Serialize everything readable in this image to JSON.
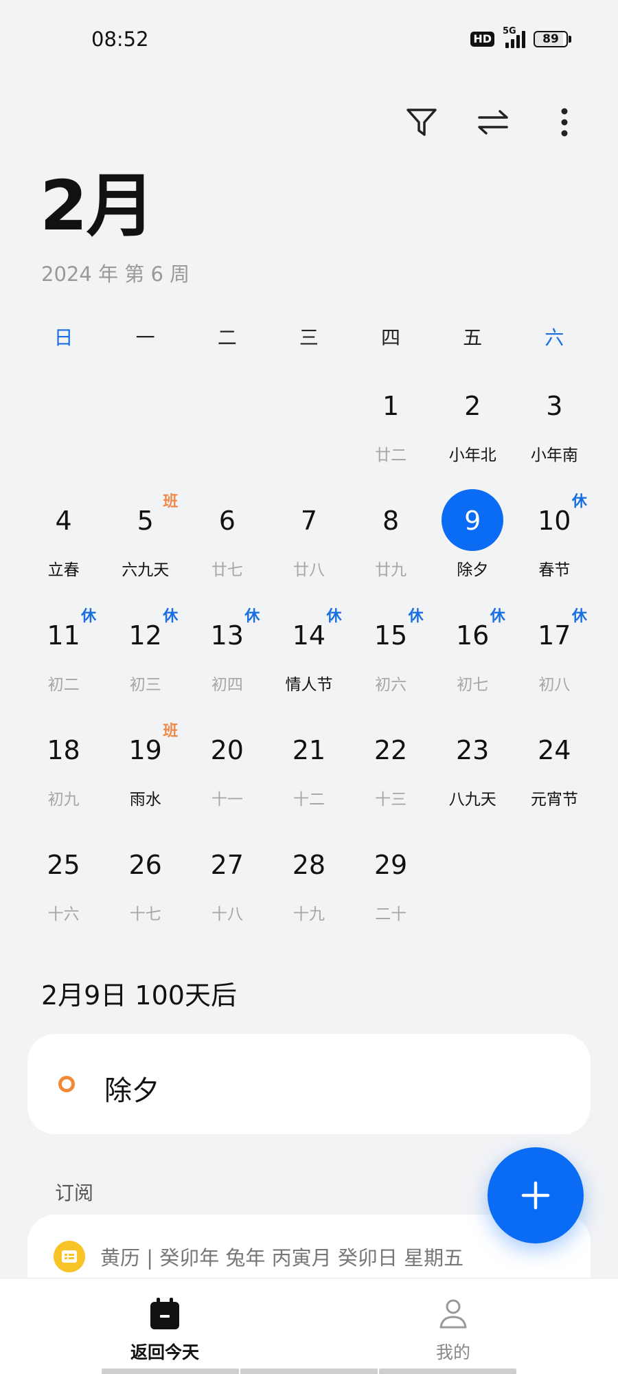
{
  "status_bar": {
    "time": "08:52",
    "hd": "HD",
    "network": "5G",
    "battery": "89"
  },
  "toolbar": {
    "filter_icon": "filter-icon",
    "switch_icon": "swap-icon",
    "more_icon": "more-vertical-icon"
  },
  "header": {
    "month": "2月",
    "subtitle": "2024 年 第 6 周"
  },
  "weekdays": [
    "日",
    "一",
    "二",
    "三",
    "四",
    "五",
    "六"
  ],
  "calendar": {
    "weeks": [
      [
        {
          "day": "",
          "lunar": "",
          "dark": false,
          "badge": ""
        },
        {
          "day": "",
          "lunar": "",
          "dark": false,
          "badge": ""
        },
        {
          "day": "",
          "lunar": "",
          "dark": false,
          "badge": ""
        },
        {
          "day": "",
          "lunar": "",
          "dark": false,
          "badge": ""
        },
        {
          "day": "1",
          "lunar": "廿二",
          "dark": false,
          "badge": ""
        },
        {
          "day": "2",
          "lunar": "小年北",
          "dark": true,
          "badge": ""
        },
        {
          "day": "3",
          "lunar": "小年南",
          "dark": true,
          "badge": ""
        }
      ],
      [
        {
          "day": "4",
          "lunar": "立春",
          "dark": true,
          "badge": ""
        },
        {
          "day": "5",
          "lunar": "六九天",
          "dark": true,
          "badge": "班"
        },
        {
          "day": "6",
          "lunar": "廿七",
          "dark": false,
          "badge": ""
        },
        {
          "day": "7",
          "lunar": "廿八",
          "dark": false,
          "badge": ""
        },
        {
          "day": "8",
          "lunar": "廿九",
          "dark": false,
          "badge": ""
        },
        {
          "day": "9",
          "lunar": "除夕",
          "dark": true,
          "badge": "",
          "selected": true
        },
        {
          "day": "10",
          "lunar": "春节",
          "dark": true,
          "badge": "休"
        }
      ],
      [
        {
          "day": "11",
          "lunar": "初二",
          "dark": false,
          "badge": "休"
        },
        {
          "day": "12",
          "lunar": "初三",
          "dark": false,
          "badge": "休"
        },
        {
          "day": "13",
          "lunar": "初四",
          "dark": false,
          "badge": "休"
        },
        {
          "day": "14",
          "lunar": "情人节",
          "dark": true,
          "badge": "休"
        },
        {
          "day": "15",
          "lunar": "初六",
          "dark": false,
          "badge": "休"
        },
        {
          "day": "16",
          "lunar": "初七",
          "dark": false,
          "badge": "休"
        },
        {
          "day": "17",
          "lunar": "初八",
          "dark": false,
          "badge": "休"
        }
      ],
      [
        {
          "day": "18",
          "lunar": "初九",
          "dark": false,
          "badge": ""
        },
        {
          "day": "19",
          "lunar": "雨水",
          "dark": true,
          "badge": "班"
        },
        {
          "day": "20",
          "lunar": "十一",
          "dark": false,
          "badge": ""
        },
        {
          "day": "21",
          "lunar": "十二",
          "dark": false,
          "badge": ""
        },
        {
          "day": "22",
          "lunar": "十三",
          "dark": false,
          "badge": ""
        },
        {
          "day": "23",
          "lunar": "八九天",
          "dark": true,
          "badge": ""
        },
        {
          "day": "24",
          "lunar": "元宵节",
          "dark": true,
          "badge": ""
        }
      ],
      [
        {
          "day": "25",
          "lunar": "十六",
          "dark": false,
          "badge": ""
        },
        {
          "day": "26",
          "lunar": "十七",
          "dark": false,
          "badge": ""
        },
        {
          "day": "27",
          "lunar": "十八",
          "dark": false,
          "badge": ""
        },
        {
          "day": "28",
          "lunar": "十九",
          "dark": false,
          "badge": ""
        },
        {
          "day": "29",
          "lunar": "二十",
          "dark": false,
          "badge": ""
        },
        {
          "day": "",
          "lunar": "",
          "dark": false,
          "badge": ""
        },
        {
          "day": "",
          "lunar": "",
          "dark": false,
          "badge": ""
        }
      ]
    ]
  },
  "selected_info": {
    "text": "2月9日   100天后"
  },
  "event": {
    "title": "除夕"
  },
  "subscription": {
    "label": "订阅",
    "almanac": "黄历 | 癸卯年 兔年 丙寅月 癸卯日 星期五"
  },
  "fab": {
    "icon": "plus-icon"
  },
  "bottom_nav": {
    "today_label": "返回今天",
    "mine_label": "我的"
  },
  "colors": {
    "accent": "#0a6cf5",
    "rest_badge": "#1a6fe0",
    "work_badge": "#f08a4b",
    "background": "#f2f3f5"
  }
}
